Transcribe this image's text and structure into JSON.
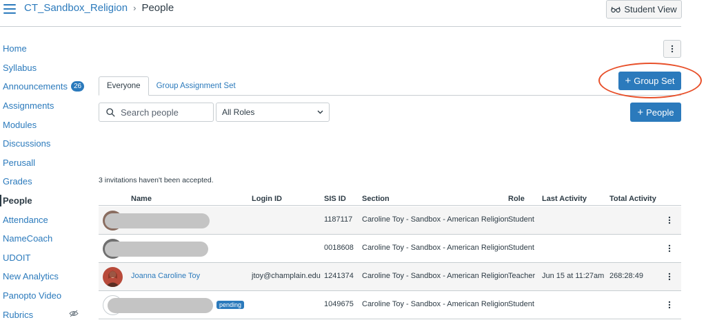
{
  "header": {
    "breadcrumb_course": "CT_Sandbox_Religion",
    "breadcrumb_separator": "›",
    "breadcrumb_current": "People",
    "student_view_label": "Student View"
  },
  "sidebar": {
    "items": [
      {
        "label": "Home"
      },
      {
        "label": "Syllabus"
      },
      {
        "label": "Announcements",
        "badge": "26"
      },
      {
        "label": "Assignments"
      },
      {
        "label": "Modules"
      },
      {
        "label": "Discussions"
      },
      {
        "label": "Perusall"
      },
      {
        "label": "Grades"
      },
      {
        "label": "People",
        "active": true
      },
      {
        "label": "Attendance"
      },
      {
        "label": "NameCoach"
      },
      {
        "label": "UDOIT"
      },
      {
        "label": "New Analytics"
      },
      {
        "label": "Panopto Video"
      },
      {
        "label": "Rubrics",
        "icon": "eye-slash-icon"
      }
    ]
  },
  "tabs": [
    {
      "label": "Everyone",
      "active": true
    },
    {
      "label": "Group Assignment Set",
      "active": false
    }
  ],
  "buttons": {
    "group_set": "Group Set",
    "people": "People",
    "plus": "+"
  },
  "search": {
    "placeholder": "Search people"
  },
  "roles_select": {
    "selected": "All Roles"
  },
  "invitations_text": "3 invitations haven't been accepted.",
  "table": {
    "headers": [
      "Name",
      "Login ID",
      "SIS ID",
      "Section",
      "Role",
      "Last Activity",
      "Total Activity"
    ],
    "rows": [
      {
        "name": "",
        "login_id": "",
        "sis_id": "1187117",
        "section": "Caroline Toy - Sandbox - American Religion",
        "role": "Student",
        "last_activity": "",
        "total_activity": ""
      },
      {
        "name": "",
        "login_id": "",
        "sis_id": "0018608",
        "section": "Caroline Toy - Sandbox - American Religion",
        "role": "Student",
        "last_activity": "",
        "total_activity": ""
      },
      {
        "name": "Joanna Caroline Toy",
        "login_id": "jtoy@champlain.edu",
        "sis_id": "1241374",
        "section": "Caroline Toy - Sandbox - American Religion",
        "role": "Teacher",
        "last_activity": "Jun 15 at 11:27am",
        "total_activity": "268:28:49"
      },
      {
        "name": "",
        "login_id": "",
        "sis_id": "1049675",
        "section": "Caroline Toy - Sandbox - American Religion",
        "role": "Student",
        "last_activity": "",
        "total_activity": "",
        "status": "pending"
      }
    ]
  },
  "colors": {
    "link": "#2b7abc",
    "primary_button": "#2b7abc",
    "highlight_ring": "#e8502a",
    "border": "#c7cdd1"
  }
}
